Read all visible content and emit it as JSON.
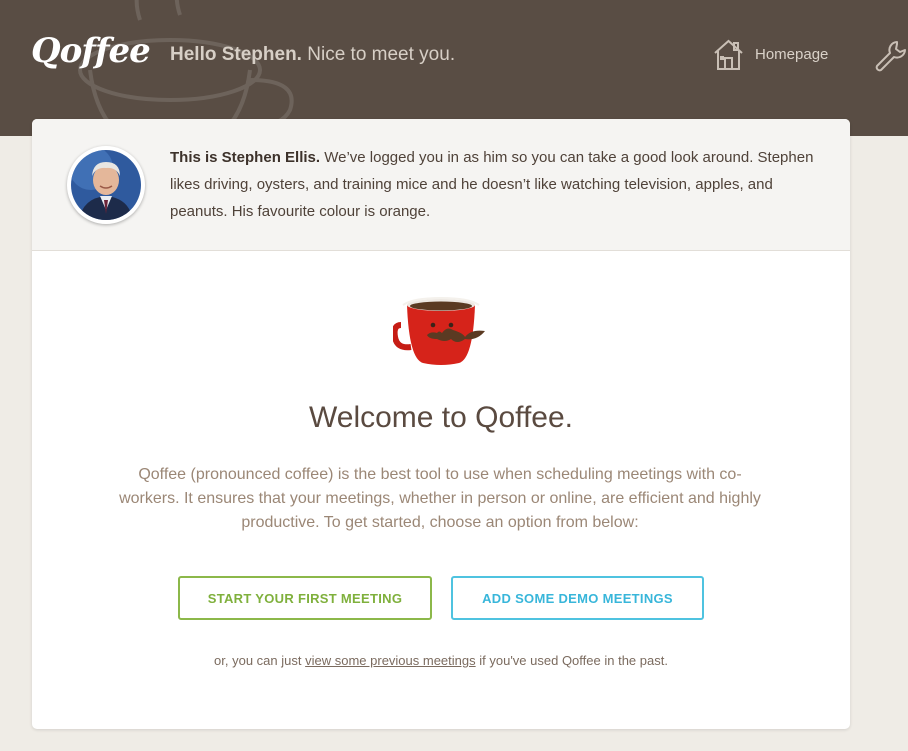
{
  "header": {
    "logo": "Qoffee",
    "greeting_bold": "Hello Stephen.",
    "greeting_rest": " Nice to meet you.",
    "nav_homepage": "Homepage"
  },
  "profile": {
    "intro_bold": "This is Stephen Ellis.",
    "intro_text": " We’ve logged you in as him so you can take a good look around. Stephen likes driving, oysters, and training mice and he doesn’t like watching television, apples, and peanuts. His favourite colour is orange."
  },
  "main": {
    "welcome_title": "Welcome to Qoffee.",
    "description": "Qoffee (pronounced coffee) is the best tool to use when scheduling meetings with co-workers. It ensures that your meetings, whether in person or online, are efficient and highly productive. To get started, choose an option from below:",
    "btn_start": "START YOUR FIRST MEETING",
    "btn_demo": "ADD SOME DEMO MEETINGS",
    "footnote_prefix": "or, you can just ",
    "footnote_link": "view some previous meetings",
    "footnote_suffix": " if you've used Qoffee in the past."
  },
  "icons": {
    "home": "home-icon",
    "wrench": "wrench-icon",
    "mug": "coffee-mug-icon"
  },
  "colors": {
    "header_bg": "#594d44",
    "page_bg": "#efece6",
    "accent_green": "#8cb84a",
    "accent_blue": "#4fc3e0",
    "mug_red": "#d6231a"
  }
}
